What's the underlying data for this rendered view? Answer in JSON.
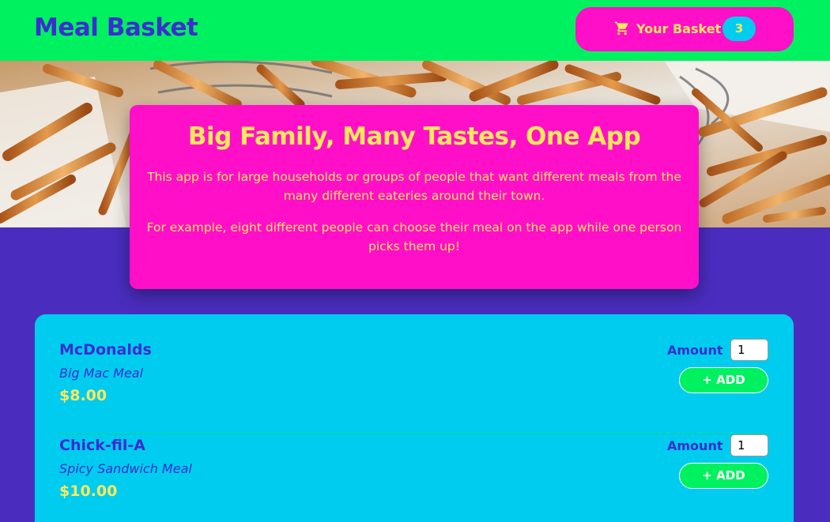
{
  "header": {
    "logo": "Meal Basket",
    "basket_label": "Your Basket",
    "basket_count": "3",
    "cart_icon": "shopping-cart-icon"
  },
  "hero": {
    "image": "french-fries-photo"
  },
  "intro": {
    "title": "Big Family, Many Tastes, One App",
    "paragraph_1": "This app is for large households or groups of people that want different meals from the many different eateries around their town.",
    "paragraph_2": "For example, eight different people can choose their meal on the app while one person picks them up!"
  },
  "meals": [
    {
      "name": "McDonalds",
      "description": "Big Mac Meal",
      "price": "$8.00",
      "amount_label": "Amount",
      "amount_value": "1",
      "add_label": "+ ADD"
    },
    {
      "name": "Chick-fil-A",
      "description": "Spicy Sandwich Meal",
      "price": "$10.00",
      "amount_label": "Amount",
      "amount_value": "1",
      "add_label": "+ ADD"
    }
  ],
  "colors": {
    "header_bg": "#00f15f",
    "accent_pink": "#ff0fc8",
    "accent_yellow": "#ffe85c",
    "accent_cyan": "#00ccef",
    "page_bg": "#4a2dbf",
    "text_indigo": "#3b2ed0"
  }
}
